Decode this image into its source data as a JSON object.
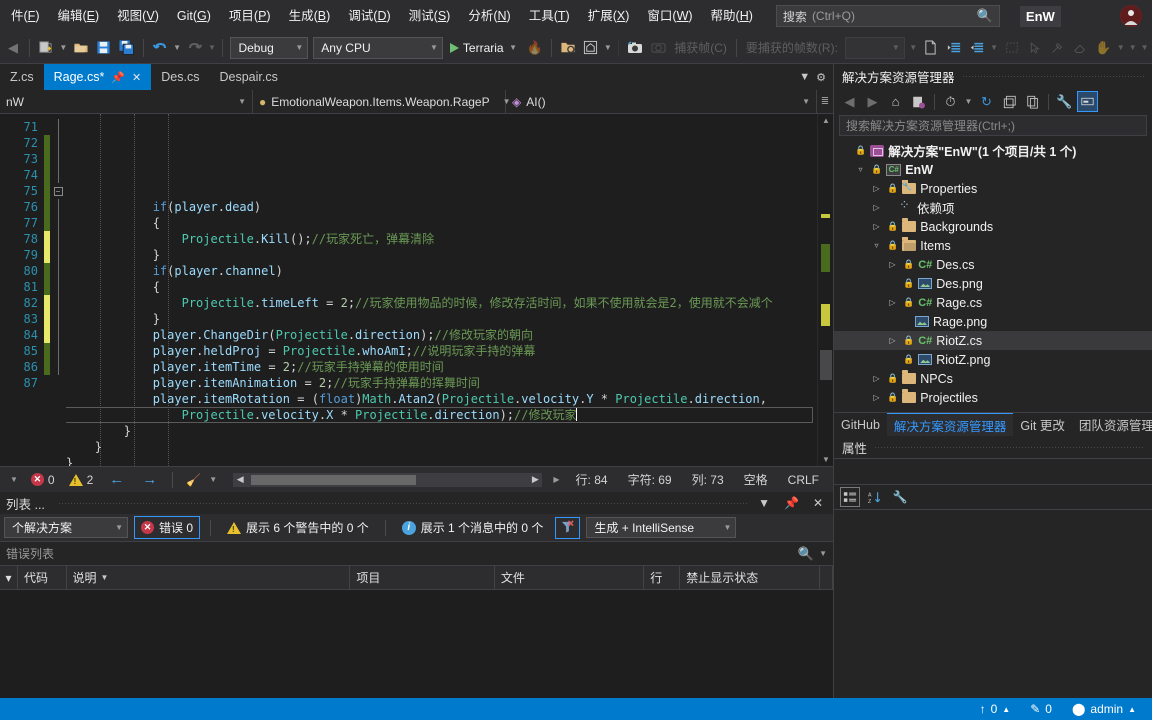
{
  "menubar": {
    "items": [
      {
        "label": "件(F)",
        "accel": "F"
      },
      {
        "label": "编辑(E)",
        "accel": "E"
      },
      {
        "label": "视图(V)",
        "accel": "V"
      },
      {
        "label": "Git(G)",
        "accel": "G"
      },
      {
        "label": "项目(P)",
        "accel": "P"
      },
      {
        "label": "生成(B)",
        "accel": "B"
      },
      {
        "label": "调试(D)",
        "accel": "D"
      },
      {
        "label": "测试(S)",
        "accel": "S"
      },
      {
        "label": "分析(N)",
        "accel": "N"
      },
      {
        "label": "工具(T)",
        "accel": "T"
      },
      {
        "label": "扩展(X)",
        "accel": "X"
      },
      {
        "label": "窗口(W)",
        "accel": "W"
      },
      {
        "label": "帮助(H)",
        "accel": "H"
      }
    ],
    "search_label": "搜索",
    "search_hint": "(Ctrl+Q)",
    "search_icon": "search-icon",
    "env_badge": "EnW",
    "avatar_icon": "user-avatar"
  },
  "toolbar": {
    "back_icon": "navigate-back-icon",
    "new_project_icon": "new-project-icon",
    "open_icon": "open-file-icon",
    "save_icon": "save-icon",
    "save_all_icon": "save-all-icon",
    "undo_icon": "undo-icon",
    "redo_icon": "redo-icon",
    "config_value": "Debug",
    "platform_value": "Any CPU",
    "run_label": "Terraria",
    "run_icon": "play-icon",
    "hot_reload_icon": "hot-reload-icon",
    "preview_icon": "preview-browser-icon",
    "live_visual_tree_icon": "live-visual-tree-icon",
    "camera_icon": "capture-frame-icon",
    "capture_frame_label": "捕获帧(C)",
    "frames_to_capture_label": "要捕获的帧数(R):",
    "frames_to_capture_value": "",
    "doc_icon": "new-document-icon",
    "indent_icon": "increase-indent-icon",
    "outdent_icon": "decrease-indent-icon",
    "select_icon": "select-rect-icon",
    "pointer_icon": "pointer-icon",
    "eyedropper_icon": "eyedropper-icon",
    "eraser_icon": "eraser-icon",
    "hand_icon": "pan-hand-icon"
  },
  "editor": {
    "tabs": [
      {
        "label": "Z.cs",
        "active": false,
        "dirty": false
      },
      {
        "label": "Rage.cs*",
        "active": true,
        "dirty": true,
        "pin_icon": "pin-icon",
        "close_icon": "close-icon"
      },
      {
        "label": "Des.cs",
        "active": false,
        "dirty": false
      },
      {
        "label": "Despair.cs",
        "active": false,
        "dirty": false
      }
    ],
    "tabstrip_overflow_icon": "chevron-down-icon",
    "tabstrip_settings_icon": "gear-icon",
    "navbar": {
      "project": "nW",
      "type": "EmotionalWeapon.Items.Weapon.RageP",
      "member": "AI()",
      "split_icon": "split-view-icon"
    },
    "first_line_number": 71,
    "lines": [
      {
        "num": 71,
        "change": "none",
        "fold": "",
        "text_html": "            <span class=\"kw\">if</span><span class=\"pl\">(</span><span class=\"id\">player</span><span class=\"pl\">.</span><span class=\"id\">dead</span><span class=\"pl\">)</span>"
      },
      {
        "num": 72,
        "change": "saved",
        "fold": "",
        "text_html": "            <span class=\"pl\">{</span>"
      },
      {
        "num": 73,
        "change": "saved",
        "fold": "",
        "text_html": "                <span class=\"ty\">Projectile</span><span class=\"pl\">.</span><span class=\"id\">Kill</span><span class=\"pl\">();</span><span class=\"cm\">//玩家死亡，弹幕清除</span>"
      },
      {
        "num": 74,
        "change": "saved",
        "fold": "",
        "text_html": "            <span class=\"pl\">}</span>"
      },
      {
        "num": 75,
        "change": "saved",
        "fold": "collapse",
        "text_html": "            <span class=\"kw\">if</span><span class=\"pl\">(</span><span class=\"id\">player</span><span class=\"pl\">.</span><span class=\"id\">channel</span><span class=\"pl\">)</span>"
      },
      {
        "num": 76,
        "change": "saved",
        "fold": "",
        "text_html": "            <span class=\"pl\">{</span>"
      },
      {
        "num": 77,
        "change": "saved",
        "fold": "",
        "text_html": "                <span class=\"ty\">Projectile</span><span class=\"pl\">.</span><span class=\"id\">timeLeft</span> <span class=\"pl\">=</span> <span class=\"num\">2</span><span class=\"pl\">;</span><span class=\"cm\">//玩家使用物品的时候，修改存活时间，如果不使用就会是2，使用就不会减个</span>"
      },
      {
        "num": 78,
        "change": "unsaved",
        "fold": "",
        "text_html": "            <span class=\"pl\">}</span>"
      },
      {
        "num": 79,
        "change": "unsaved",
        "fold": "",
        "text_html": "            <span class=\"id\">player</span><span class=\"pl\">.</span><span class=\"id\">ChangeDir</span><span class=\"pl\">(</span><span class=\"ty\">Projectile</span><span class=\"pl\">.</span><span class=\"id\">direction</span><span class=\"pl\">);</span><span class=\"cm\">//修改玩家的朝向</span>"
      },
      {
        "num": 80,
        "change": "saved",
        "fold": "",
        "text_html": "            <span class=\"id\">player</span><span class=\"pl\">.</span><span class=\"id\">heldProj</span> <span class=\"pl\">=</span> <span class=\"ty\">Projectile</span><span class=\"pl\">.</span><span class=\"id\">whoAmI</span><span class=\"pl\">;</span><span class=\"cm\">//说明玩家手持的弹幕</span>"
      },
      {
        "num": 81,
        "change": "saved",
        "fold": "",
        "text_html": "            <span class=\"id\">player</span><span class=\"pl\">.</span><span class=\"id\">itemTime</span> <span class=\"pl\">=</span> <span class=\"num\">2</span><span class=\"pl\">;</span><span class=\"cm\">//玩家手持弹幕的使用时间</span>"
      },
      {
        "num": 82,
        "change": "unsaved",
        "fold": "",
        "text_html": "            <span class=\"id\">player</span><span class=\"pl\">.</span><span class=\"id\">itemAnimation</span> <span class=\"pl\">=</span> <span class=\"num\">2</span><span class=\"pl\">;</span><span class=\"cm\">//玩家手持弹幕的挥舞时间</span>"
      },
      {
        "num": 83,
        "change": "unsaved",
        "fold": "",
        "text_html": "            <span class=\"id\">player</span><span class=\"pl\">.</span><span class=\"id\">itemRotation</span> <span class=\"pl\">=</span> <span class=\"pl\">(</span><span class=\"kw\">float</span><span class=\"pl\">)</span><span class=\"ty\">Math</span><span class=\"pl\">.</span><span class=\"id\">Atan2</span><span class=\"pl\">(</span><span class=\"ty\">Projectile</span><span class=\"pl\">.</span><span class=\"id\">velocity</span><span class=\"pl\">.</span><span class=\"id\">Y</span> <span class=\"pl\">*</span> <span class=\"ty\">Projectile</span><span class=\"pl\">.</span><span class=\"id\">direction</span><span class=\"pl\">,</span>"
      },
      {
        "num": 84,
        "change": "unsaved",
        "fold": "",
        "current": true,
        "text_html": "                <span class=\"ty\">Projectile</span><span class=\"pl\">.</span><span class=\"id\">velocity</span><span class=\"pl\">.</span><span class=\"id\">X</span> <span class=\"pl\">*</span> <span class=\"ty\">Projectile</span><span class=\"pl\">.</span><span class=\"id\">direction</span><span class=\"pl\">);</span><span class=\"cm\">//修改玩家</span><span class=\"caret\"></span>"
      },
      {
        "num": 85,
        "change": "saved",
        "fold": "",
        "text_html": "        <span class=\"pl\">}</span>"
      },
      {
        "num": 86,
        "change": "saved",
        "fold": "",
        "text_html": "    <span class=\"pl\">}</span>"
      },
      {
        "num": 87,
        "change": "none",
        "fold": "",
        "text_html": "<span class=\"pl\">}</span>"
      }
    ],
    "status": {
      "expand_icon": "chevron-down-icon",
      "error_count": "0",
      "warning_count": "2",
      "prev_icon": "navigate-prev-icon",
      "next_icon": "navigate-next-icon",
      "broom_icon": "code-cleanup-icon",
      "line_label": "行: 84",
      "char_label": "字符: 69",
      "col_label": "列: 73",
      "spaces_label": "空格",
      "eol_label": "CRLF"
    }
  },
  "errorlist": {
    "title": "列表 ...",
    "pin_icon": "pin-icon",
    "close_icon": "close-icon",
    "dropdown_icon": "chevron-down-icon",
    "scope_value": "个解决方案",
    "errors_label": "错误 0",
    "warnings_label": "展示 6 个警告中的 0 个",
    "messages_label": "展示 1 个消息中的 0 个",
    "build_filter_icon": "filter-build-icon",
    "source_value": "生成 + IntelliSense",
    "search_placeholder": "错误列表",
    "search_icon": "search-icon",
    "columns": [
      "代码",
      "说明",
      "项目",
      "文件",
      "行",
      "禁止显示状态"
    ],
    "sort_icon": "sort-descending-icon",
    "rows": []
  },
  "solution_explorer": {
    "title": "解决方案资源管理器",
    "toolbar": {
      "back_icon": "navigate-back-icon",
      "forward_icon": "navigate-forward-icon",
      "home_icon": "home-icon",
      "pending_changes_icon": "pending-changes-icon",
      "history_icon": "history-icon",
      "refresh_icon": "refresh-icon",
      "collapse_all_icon": "collapse-all-icon",
      "show_all_files_icon": "show-all-files-icon",
      "properties_icon": "properties-wrench-icon",
      "preview_pane_icon": "preview-selected-items-icon"
    },
    "search_placeholder": "搜索解决方案资源管理器(Ctrl+;)",
    "tree": [
      {
        "label": "解决方案\"EnW\"(1 个项目/共 1 个)",
        "indent": 0,
        "arrow": "",
        "icon": "solution-icon",
        "locked": true,
        "bold": true
      },
      {
        "label": "EnW",
        "indent": 1,
        "arrow": "open",
        "icon": "csproj-icon",
        "locked": true,
        "bold": true
      },
      {
        "label": "Properties",
        "indent": 2,
        "arrow": "closed",
        "icon": "properties-folder-icon",
        "locked": true
      },
      {
        "label": "依赖项",
        "indent": 2,
        "arrow": "closed",
        "icon": "dependencies-icon",
        "locked": false
      },
      {
        "label": "Backgrounds",
        "indent": 2,
        "arrow": "closed",
        "icon": "folder-icon",
        "locked": true
      },
      {
        "label": "Items",
        "indent": 2,
        "arrow": "open",
        "icon": "folder-open-icon",
        "locked": true
      },
      {
        "label": "Des.cs",
        "indent": 3,
        "arrow": "closed",
        "icon": "csharp-file-icon",
        "locked": true
      },
      {
        "label": "Des.png",
        "indent": 3,
        "arrow": "",
        "icon": "image-file-icon",
        "locked": true
      },
      {
        "label": "Rage.cs",
        "indent": 3,
        "arrow": "closed",
        "icon": "csharp-file-icon",
        "locked": true
      },
      {
        "label": "Rage.png",
        "indent": 3,
        "arrow": "",
        "icon": "image-file-icon",
        "locked": false
      },
      {
        "label": "RiotZ.cs",
        "indent": 3,
        "arrow": "closed",
        "icon": "csharp-file-icon",
        "locked": true,
        "selected": true
      },
      {
        "label": "RiotZ.png",
        "indent": 3,
        "arrow": "",
        "icon": "image-file-icon",
        "locked": true
      },
      {
        "label": "NPCs",
        "indent": 2,
        "arrow": "closed",
        "icon": "folder-icon",
        "locked": true
      },
      {
        "label": "Projectiles",
        "indent": 2,
        "arrow": "closed",
        "icon": "folder-icon",
        "locked": true
      }
    ],
    "tabs": [
      {
        "label": "GitHub",
        "active": false
      },
      {
        "label": "解决方案资源管理器",
        "active": true
      },
      {
        "label": "Git 更改",
        "active": false
      },
      {
        "label": "团队资源管理器",
        "active": false
      }
    ]
  },
  "properties": {
    "title": "属性",
    "categorized_icon": "categorized-view-icon",
    "alphabetical_icon": "alphabetical-sort-icon",
    "property_pages_icon": "property-pages-icon"
  },
  "statusbar": {
    "push_icon": "push-up-icon",
    "push_count": "0",
    "push_caret_icon": "caret-up-icon",
    "pencil_icon": "pencil-edit-icon",
    "edit_count": "0",
    "branch_icon": "source-branch-icon",
    "branch_name": "admin",
    "branch_caret_icon": "caret-up-icon"
  },
  "colors": {
    "accent": "#007acc",
    "chrome": "#2d2d30",
    "panel": "#252526",
    "editor_bg": "#1e1e1e",
    "comment_green": "#6a9955",
    "keyword_blue": "#569cd6",
    "type_teal": "#4ec9b0",
    "linenum_blue": "#2b91af",
    "error_red": "#c5384a",
    "warning_yellow": "#e8c02c"
  }
}
